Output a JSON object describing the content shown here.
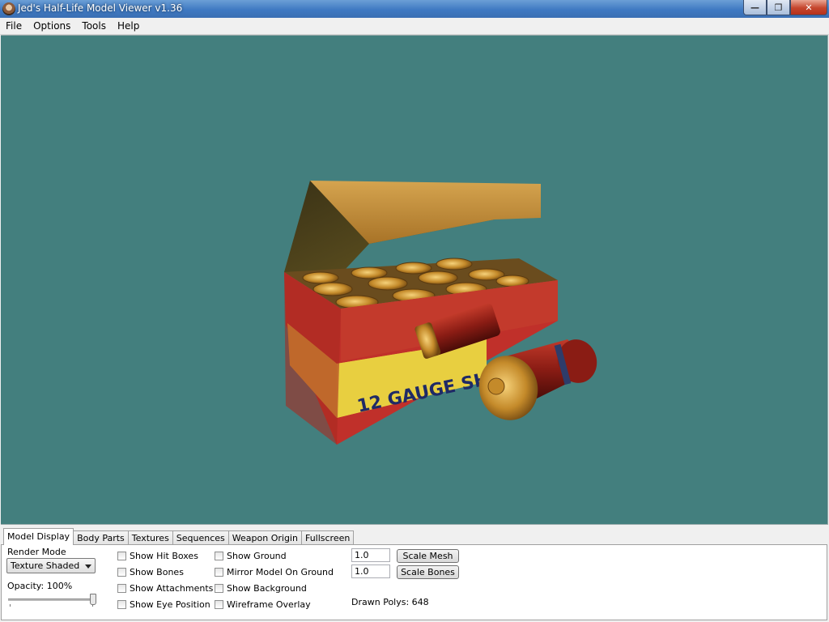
{
  "window": {
    "title": "Jed's Half-Life Model Viewer v1.36"
  },
  "menu": [
    "File",
    "Options",
    "Tools",
    "Help"
  ],
  "viewport": {
    "background": "#437f7e",
    "model_label": "12 GAUGE SHOT"
  },
  "tabs": [
    "Model Display",
    "Body Parts",
    "Textures",
    "Sequences",
    "Weapon Origin",
    "Fullscreen"
  ],
  "model_display": {
    "render_mode_label": "Render Mode",
    "render_mode_value": "Texture Shaded",
    "opacity_label": "Opacity: 100%",
    "opacity_value": 1.0,
    "checkboxes_col1": [
      "Show Hit Boxes",
      "Show Bones",
      "Show Attachments",
      "Show Eye Position"
    ],
    "checkboxes_col2": [
      "Show Ground",
      "Mirror Model On Ground",
      "Show Background",
      "Wireframe Overlay"
    ],
    "scale_mesh_value": "1.0",
    "scale_mesh_button": "Scale Mesh",
    "scale_bones_value": "1.0",
    "scale_bones_button": "Scale Bones",
    "drawn_polys": "Drawn Polys: 648"
  }
}
